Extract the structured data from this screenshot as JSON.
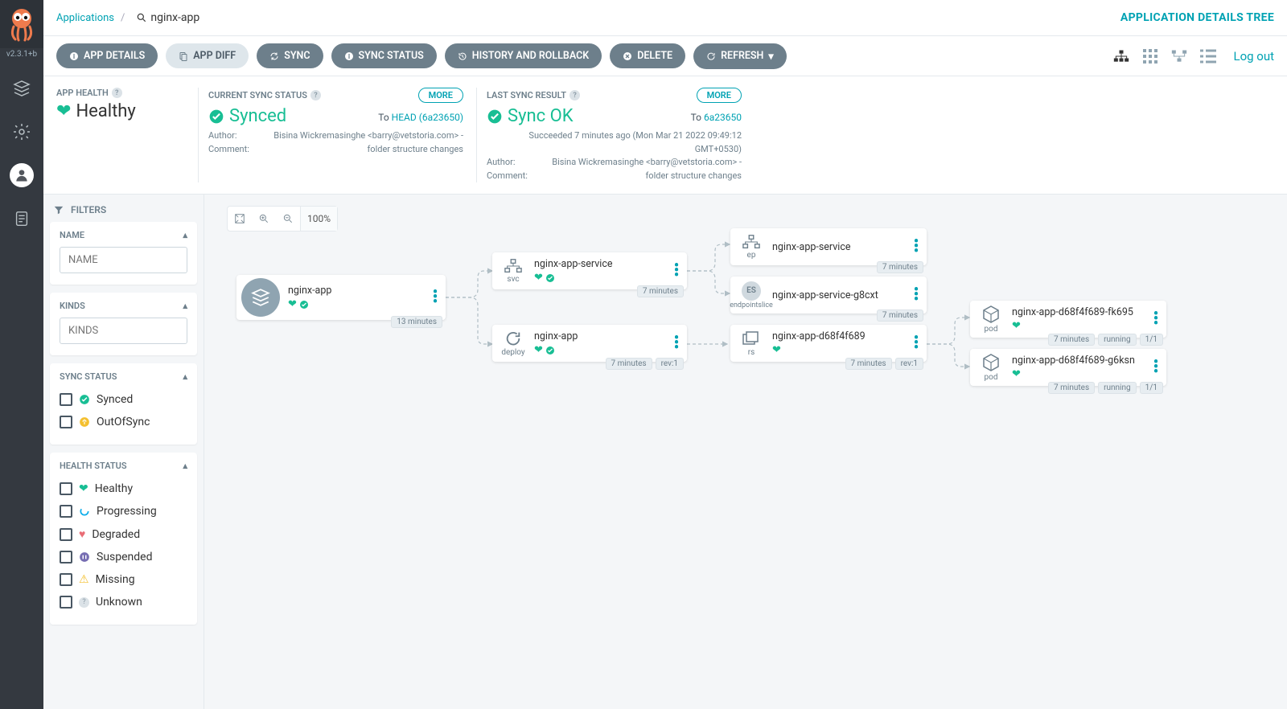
{
  "version": "v2.3.1+b",
  "breadcrumb": {
    "root": "Applications",
    "current": "nginx-app"
  },
  "page_title_right": "APPLICATION DETAILS TREE",
  "actions": {
    "app_details": "APP DETAILS",
    "app_diff": "APP DIFF",
    "sync": "SYNC",
    "sync_status": "SYNC STATUS",
    "history": "HISTORY AND ROLLBACK",
    "delete": "DELETE",
    "refresh": "REFRESH",
    "logout": "Log out"
  },
  "status": {
    "health": {
      "label": "APP HEALTH",
      "value": "Healthy"
    },
    "sync": {
      "label": "CURRENT SYNC STATUS",
      "value": "Synced",
      "more": "MORE",
      "to_label": "To ",
      "to_link": "HEAD (6a23650)",
      "author_label": "Author:",
      "author": "Bisina Wickremasinghe <barry@vetstoria.com> -",
      "comment_label": "Comment:",
      "comment": "folder structure changes"
    },
    "last": {
      "label": "LAST SYNC RESULT",
      "value": "Sync OK",
      "more": "MORE",
      "to_label": "To ",
      "to_link": "6a23650",
      "succeeded": "Succeeded 7 minutes ago (Mon Mar 21 2022 09:49:12 GMT+0530)",
      "author_label": "Author:",
      "author": "Bisina Wickremasinghe <barry@vetstoria.com> -",
      "comment_label": "Comment:",
      "comment": "folder structure changes"
    }
  },
  "filters": {
    "title": "FILTERS",
    "name": {
      "label": "NAME",
      "placeholder": "NAME"
    },
    "kinds": {
      "label": "KINDS",
      "placeholder": "KINDS"
    },
    "sync": {
      "label": "SYNC STATUS",
      "options": [
        "Synced",
        "OutOfSync"
      ]
    },
    "health": {
      "label": "HEALTH STATUS",
      "options": [
        "Healthy",
        "Progressing",
        "Degraded",
        "Suspended",
        "Missing",
        "Unknown"
      ]
    }
  },
  "zoom": "100%",
  "tree": {
    "root": {
      "title": "nginx-app",
      "age": "13 minutes"
    },
    "svc": {
      "kind": "svc",
      "title": "nginx-app-service",
      "age": "7 minutes"
    },
    "deploy": {
      "kind": "deploy",
      "title": "nginx-app",
      "age": "7 minutes",
      "rev": "rev:1"
    },
    "ep": {
      "kind": "ep",
      "title": "nginx-app-service",
      "age": "7 minutes"
    },
    "eps": {
      "kind": "endpointslice",
      "title": "nginx-app-service-g8cxt",
      "age": "7 minutes"
    },
    "rs": {
      "kind": "rs",
      "title": "nginx-app-d68f4f689",
      "age": "7 minutes",
      "rev": "rev:1"
    },
    "pod1": {
      "kind": "pod",
      "title": "nginx-app-d68f4f689-fk695",
      "age": "7 minutes",
      "state": "running",
      "count": "1/1"
    },
    "pod2": {
      "kind": "pod",
      "title": "nginx-app-d68f4f689-g6ksn",
      "age": "7 minutes",
      "state": "running",
      "count": "1/1"
    }
  }
}
